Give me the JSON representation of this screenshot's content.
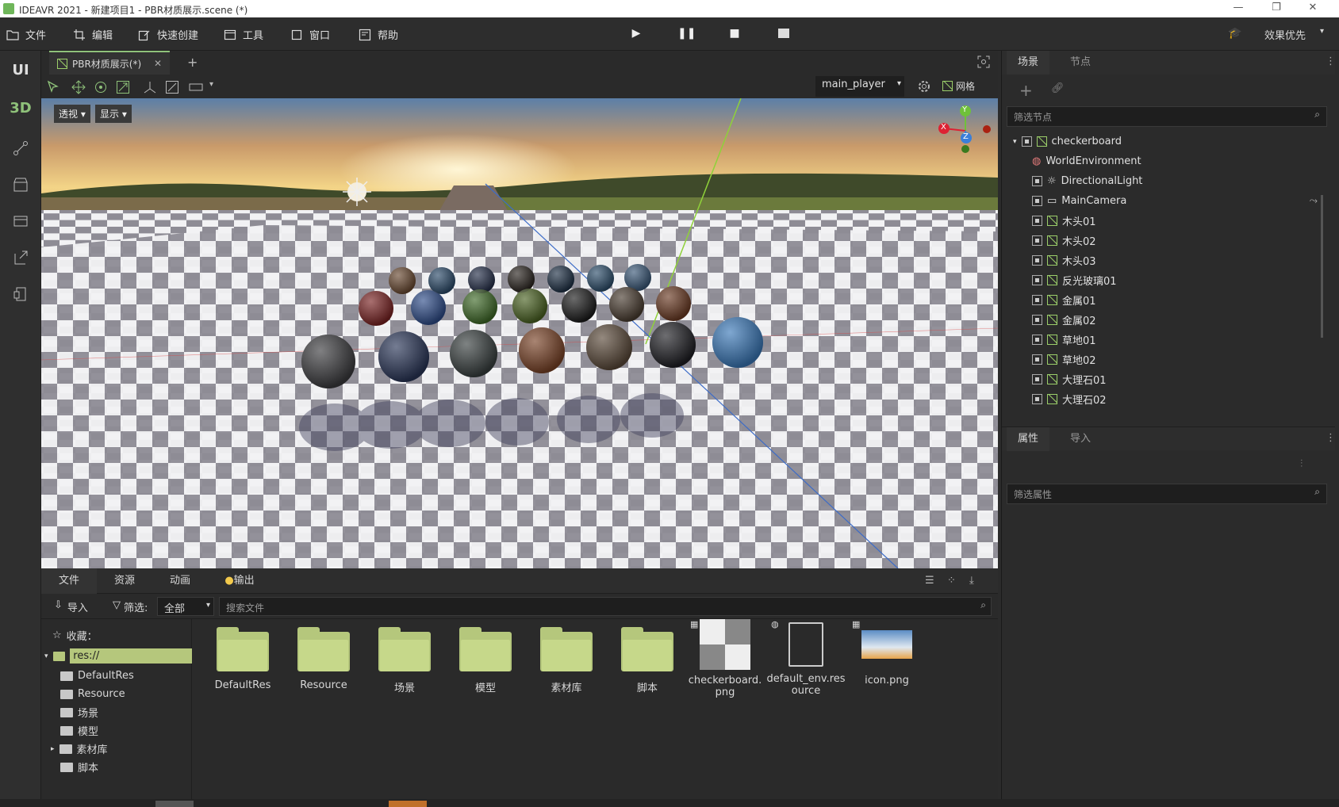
{
  "window": {
    "title": "IDEAVR 2021 - 新建项目1 - PBR材质展示.scene (*)"
  },
  "menu": [
    {
      "label": "文件",
      "icon": "folder-icon"
    },
    {
      "label": "编辑",
      "icon": "crop-icon"
    },
    {
      "label": "快速创建",
      "icon": "edit-icon"
    },
    {
      "label": "工具",
      "icon": "window-icon"
    },
    {
      "label": "窗口",
      "icon": "frame-icon"
    },
    {
      "label": "帮助",
      "icon": "help-icon"
    }
  ],
  "quality": {
    "label": "效果优先"
  },
  "leftbar": {
    "ui": "UI",
    "d3": "3D"
  },
  "scene_tab": {
    "label": "PBR材质展示(*)"
  },
  "viewport_toolbar": {
    "player": "main_player",
    "grid": "网格"
  },
  "viewport": {
    "perspective": "透视",
    "display": "显示",
    "gizmo": {
      "x": "X",
      "y": "Y",
      "z": "Z"
    }
  },
  "right_top_tabs": [
    "场景",
    "节点"
  ],
  "node_filter": {
    "placeholder": "筛选节点"
  },
  "tree": [
    {
      "label": "checkerboard",
      "type": "mesh"
    },
    {
      "label": "WorldEnvironment",
      "type": "world"
    },
    {
      "label": "DirectionalLight",
      "type": "light"
    },
    {
      "label": "MainCamera",
      "type": "camera"
    },
    {
      "label": "木头01",
      "type": "mesh"
    },
    {
      "label": "木头02",
      "type": "mesh"
    },
    {
      "label": "木头03",
      "type": "mesh"
    },
    {
      "label": "反光玻璃01",
      "type": "mesh"
    },
    {
      "label": "金属01",
      "type": "mesh"
    },
    {
      "label": "金属02",
      "type": "mesh"
    },
    {
      "label": "草地01",
      "type": "mesh"
    },
    {
      "label": "草地02",
      "type": "mesh"
    },
    {
      "label": "大理石01",
      "type": "mesh"
    },
    {
      "label": "大理石02",
      "type": "mesh"
    }
  ],
  "right_bottom_tabs": [
    "属性",
    "导入"
  ],
  "prop_filter": {
    "placeholder": "筛选属性"
  },
  "bottom_tabs": [
    "文件",
    "资源",
    "动画",
    "输出"
  ],
  "file_toolbar": {
    "import": "导入",
    "filter": "筛选:",
    "filter_value": "全部",
    "search_placeholder": "搜索文件"
  },
  "sidebar": {
    "favorites": "收藏：",
    "root": "res://",
    "folders": [
      "DefaultRes",
      "Resource",
      "场景",
      "模型",
      "素材库",
      "脚本"
    ]
  },
  "files": [
    {
      "label": "DefaultRes",
      "kind": "folder"
    },
    {
      "label": "Resource",
      "kind": "folder"
    },
    {
      "label": "场景",
      "kind": "folder"
    },
    {
      "label": "模型",
      "kind": "folder"
    },
    {
      "label": "素材库",
      "kind": "folder"
    },
    {
      "label": "脚本",
      "kind": "folder"
    },
    {
      "label": "checkerboard.png",
      "kind": "image"
    },
    {
      "label": "default_env.resource",
      "kind": "resource"
    },
    {
      "label": "icon.png",
      "kind": "image"
    }
  ]
}
